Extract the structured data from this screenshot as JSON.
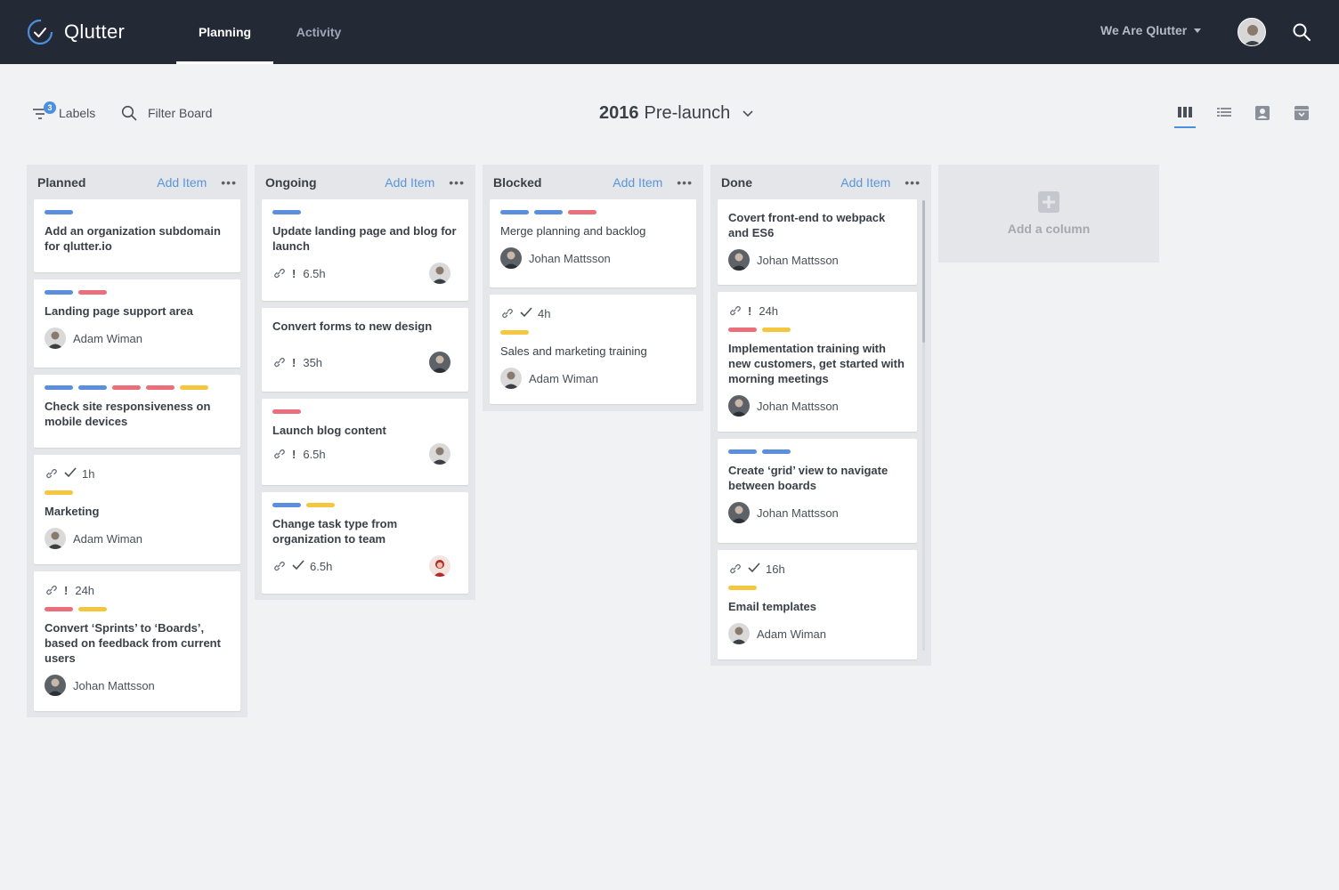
{
  "app": {
    "name": "Qlutter"
  },
  "nav": {
    "tabs": [
      {
        "label": "Planning",
        "active": true
      },
      {
        "label": "Activity",
        "active": false
      }
    ]
  },
  "header": {
    "org_name": "We Are Qlutter"
  },
  "toolbar": {
    "labels_label": "Labels",
    "labels_count": "3",
    "filter_label": "Filter Board",
    "board_year": "2016",
    "board_name": "Pre-launch"
  },
  "colors": {
    "blue": "#5b8fdd",
    "red": "#ec6e7a",
    "yellow": "#f4c73e",
    "accent": "#4a8fe0"
  },
  "columns": [
    {
      "title": "Planned",
      "add_label": "Add Item",
      "cards": [
        {
          "tags": [
            "blue"
          ],
          "title": "Add an organization subdomain for qlutter.io"
        },
        {
          "tags": [
            "blue",
            "red"
          ],
          "title": "Landing page support area",
          "assignee": "Adam Wiman"
        },
        {
          "tags": [
            "blue",
            "blue",
            "red",
            "red",
            "yellow"
          ],
          "title": "Check site responsiveness on mobile devices"
        },
        {
          "meta": {
            "flag": "check",
            "hours": "1h"
          },
          "tags": [
            "yellow"
          ],
          "title": "Marketing",
          "assignee": "Adam Wiman"
        },
        {
          "meta": {
            "flag": "!",
            "hours": "24h"
          },
          "tags": [
            "red",
            "yellow"
          ],
          "title": "Convert ‘Sprints’ to ‘Boards’, based on feedback from current users",
          "assignee": "Johan Mattsson"
        }
      ]
    },
    {
      "title": "Ongoing",
      "add_label": "Add Item",
      "cards": [
        {
          "tags": [
            "blue"
          ],
          "title": "Update landing page and blog for launch",
          "meta": {
            "flag": "!",
            "hours": "6.5h"
          }
        },
        {
          "tags": [],
          "title": "Convert forms to new design",
          "meta": {
            "flag": "!",
            "hours": "35h"
          }
        },
        {
          "tags": [
            "red"
          ],
          "title": "Launch blog content",
          "meta": {
            "flag": "!",
            "hours": "6.5h"
          }
        },
        {
          "tags": [
            "blue",
            "yellow"
          ],
          "title": "Change task type from organization to team",
          "meta": {
            "flag": "check",
            "hours": "6.5h"
          }
        }
      ]
    },
    {
      "title": "Blocked",
      "add_label": "Add Item",
      "cards": [
        {
          "tags": [
            "blue",
            "blue",
            "red"
          ],
          "title": "Merge planning and backlog",
          "assignee": "Johan Mattsson"
        },
        {
          "meta": {
            "flag": "check",
            "hours": "4h"
          },
          "tags": [
            "yellow"
          ],
          "title": "Sales and marketing training",
          "assignee": "Adam Wiman"
        }
      ]
    },
    {
      "title": "Done",
      "add_label": "Add Item",
      "cards": [
        {
          "tags": [],
          "title": "Covert front-end to webpack and ES6",
          "assignee": "Johan Mattsson"
        },
        {
          "meta": {
            "flag": "!",
            "hours": "24h"
          },
          "tags": [
            "red",
            "yellow"
          ],
          "title": "Implementation training with new customers, get started with morning meetings",
          "assignee": "Johan Mattsson"
        },
        {
          "tags": [
            "blue",
            "blue"
          ],
          "title": "Create ‘grid’ view to navigate between boards",
          "assignee": "Johan Mattsson"
        },
        {
          "meta": {
            "flag": "check",
            "hours": "16h"
          },
          "tags": [
            "yellow"
          ],
          "title": "Email templates",
          "assignee": "Adam Wiman"
        }
      ]
    }
  ],
  "add_column_label": "Add a column"
}
